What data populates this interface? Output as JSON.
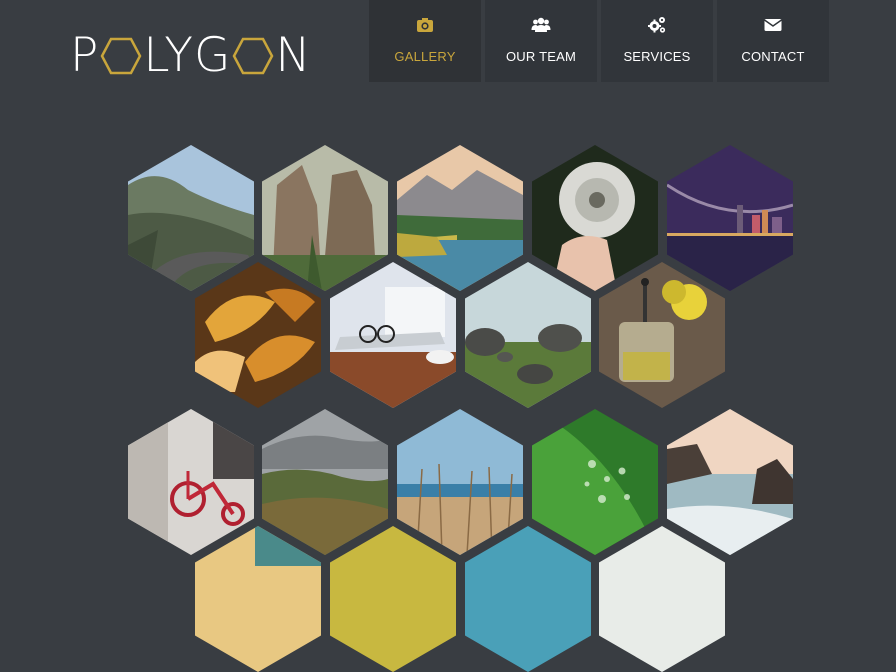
{
  "brand": {
    "logo_text_prefix": "P",
    "logo_text_middle": "LYG",
    "logo_text_suffix": "N",
    "accent": "#c9a63c"
  },
  "nav": [
    {
      "label": "GALLERY",
      "icon": "camera-icon",
      "active": true
    },
    {
      "label": "OUR TEAM",
      "icon": "users-icon",
      "active": false
    },
    {
      "label": "SERVICES",
      "icon": "gears-icon",
      "active": false
    },
    {
      "label": "CONTACT",
      "icon": "envelope-icon",
      "active": false
    }
  ],
  "gallery": [
    {
      "name": "mountain-road"
    },
    {
      "name": "rock-cliffs"
    },
    {
      "name": "lake-forest"
    },
    {
      "name": "dandelion-hand"
    },
    {
      "name": "city-bridge-night"
    },
    {
      "name": "autumn-leaves"
    },
    {
      "name": "desk-glasses"
    },
    {
      "name": "stones-field"
    },
    {
      "name": "tea-press"
    },
    {
      "name": "red-tricycle"
    },
    {
      "name": "green-hills"
    },
    {
      "name": "grass-sea"
    },
    {
      "name": "water-drops-leaf"
    },
    {
      "name": "rocky-coast"
    },
    {
      "name": "partial-1"
    },
    {
      "name": "partial-2"
    },
    {
      "name": "partial-3"
    },
    {
      "name": "partial-4"
    }
  ]
}
